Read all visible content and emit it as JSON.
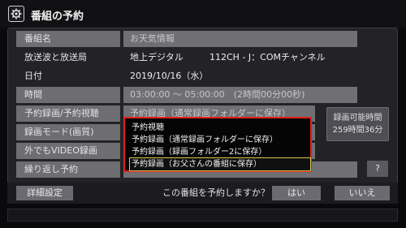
{
  "window": {
    "title": "番組の予約",
    "settings_icon": "gear-icon"
  },
  "fields": {
    "program_name": {
      "label": "番組名",
      "value": "お天気情報"
    },
    "broadcast": {
      "label": "放送波と放送局",
      "wave": "地上デジタル",
      "channel": "112CH - J：COMチャンネル"
    },
    "date": {
      "label": "日付",
      "value": "2019/10/16（水）"
    },
    "time": {
      "label": "時間",
      "value": "03:00:00 ～ 05:00:00　(2時間00分00秒)"
    },
    "reservation_type": {
      "label": "予約録画/予約視聴",
      "value": "予約録画（通常録画フォルダーに保存）"
    },
    "record_mode": {
      "label": "録画モード(画質)"
    },
    "remote_recording": {
      "label": "外でもVIDEO録画"
    },
    "repeat": {
      "label": "繰り返し予約"
    }
  },
  "recordable_time": {
    "label": "録画可能時間",
    "value": "259時間36分"
  },
  "help_button": "?",
  "dropdown": {
    "options": [
      "予約視聴",
      "予約録画（通常録画フォルダーに保存）",
      "予約録画（録画フォルダー2に保存）",
      "予約録画（お父さんの番組に保存）"
    ],
    "selected_index": 3
  },
  "bottom": {
    "details_button": "詳細設定",
    "prompt": "この番組を予約しますか？",
    "yes_button": "はい",
    "no_button": "いいえ"
  },
  "colors": {
    "highlight_border": "#e0201a",
    "selected_outline": "#d8c84a"
  }
}
